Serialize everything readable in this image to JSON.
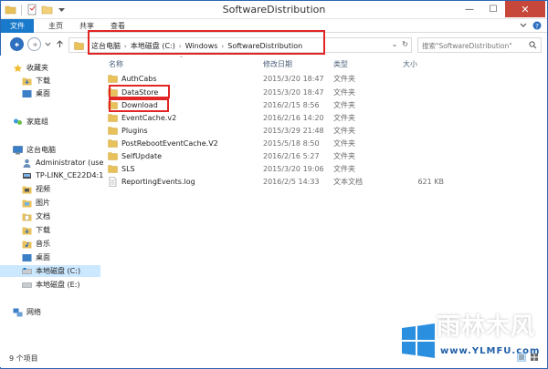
{
  "window": {
    "title": "SoftwareDistribution",
    "minimize": "—",
    "maximize": "☐",
    "close": "✕"
  },
  "ribbon": {
    "tabs": [
      "文件",
      "主页",
      "共享",
      "查看"
    ]
  },
  "address": {
    "path": [
      "这台电脑",
      "本地磁盘 (C:)",
      "Windows",
      "SoftwareDistribution"
    ],
    "search_placeholder": "搜索\"SoftwareDistribution\""
  },
  "sidebar": {
    "items": [
      {
        "label": "收藏夹",
        "icon": "star-icon"
      },
      {
        "label": "下载",
        "icon": "download-folder-icon"
      },
      {
        "label": "桌面",
        "icon": "desktop-icon"
      },
      {
        "label": "家庭组",
        "icon": "homegroup-icon"
      },
      {
        "label": "这台电脑",
        "icon": "computer-icon"
      },
      {
        "label": "Administrator (use",
        "icon": "user-icon"
      },
      {
        "label": "TP-LINK_CE22D4:1",
        "icon": "network-device-icon"
      },
      {
        "label": "视频",
        "icon": "video-folder-icon"
      },
      {
        "label": "图片",
        "icon": "picture-folder-icon"
      },
      {
        "label": "文档",
        "icon": "document-folder-icon"
      },
      {
        "label": "下载",
        "icon": "download-folder-icon"
      },
      {
        "label": "音乐",
        "icon": "music-folder-icon"
      },
      {
        "label": "桌面",
        "icon": "desktop-icon"
      },
      {
        "label": "本地磁盘 (C:)",
        "icon": "drive-icon"
      },
      {
        "label": "本地磁盘 (E:)",
        "icon": "drive-icon"
      },
      {
        "label": "网络",
        "icon": "network-icon"
      }
    ]
  },
  "columns": {
    "name": "名称",
    "date": "修改日期",
    "type": "类型",
    "size": "大小"
  },
  "files": [
    {
      "name": "AuthCabs",
      "date": "2015/3/20 18:47",
      "type": "文件夹",
      "size": ""
    },
    {
      "name": "DataStore",
      "date": "2015/3/20 18:47",
      "type": "文件夹",
      "size": ""
    },
    {
      "name": "Download",
      "date": "2016/2/15 8:56",
      "type": "文件夹",
      "size": ""
    },
    {
      "name": "EventCache.v2",
      "date": "2016/2/16 14:20",
      "type": "文件夹",
      "size": ""
    },
    {
      "name": "Plugins",
      "date": "2015/3/29 21:48",
      "type": "文件夹",
      "size": ""
    },
    {
      "name": "PostRebootEventCache.V2",
      "date": "2015/5/18 8:50",
      "type": "文件夹",
      "size": ""
    },
    {
      "name": "SelfUpdate",
      "date": "2016/2/16 5:27",
      "type": "文件夹",
      "size": ""
    },
    {
      "name": "SLS",
      "date": "2015/3/20 19:06",
      "type": "文件夹",
      "size": ""
    },
    {
      "name": "ReportingEvents.log",
      "date": "2016/2/5 14:33",
      "type": "文本文档",
      "size": "621 KB"
    }
  ],
  "status": {
    "count": "9 个项目"
  },
  "watermark": {
    "brand": "雨林木风",
    "url": "www.YLMFU.com"
  },
  "colors": {
    "accent": "#1979ca",
    "highlight": "#e22525",
    "folder": "#e8c15a",
    "selected": "#cce8ff"
  }
}
